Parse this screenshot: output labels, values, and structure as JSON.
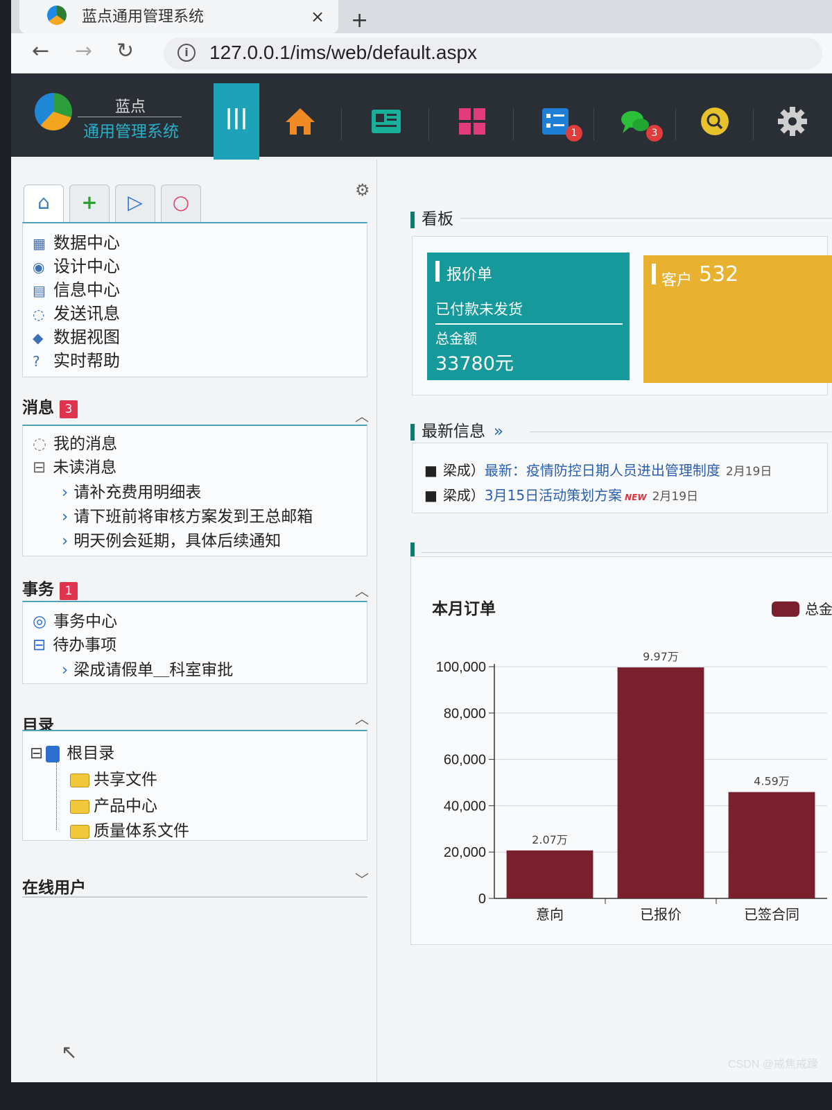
{
  "browser": {
    "tab_title": "蓝点通用管理系统",
    "tab_close": "×",
    "new_tab": "+",
    "back": "←",
    "forward": "→",
    "reload": "↻",
    "info": "i",
    "url": "127.0.0.1/ims/web/default.aspx"
  },
  "header": {
    "logo_top": "蓝点",
    "logo_bottom": "通用管理系统",
    "menu_toggle": "|||",
    "tasks_badge": "1",
    "chat_badge": "3",
    "colors": {
      "header_bg": "#2a2f36",
      "toggle": "#1ea2b8"
    }
  },
  "sidebar": {
    "menu": [
      {
        "icon": "grid-icon",
        "glyph": "▦",
        "label": "数据中心"
      },
      {
        "icon": "palette-icon",
        "glyph": "◉",
        "label": "设计中心"
      },
      {
        "icon": "document-icon",
        "glyph": "▤",
        "label": "信息中心"
      },
      {
        "icon": "chat-icon",
        "glyph": "◌",
        "label": "发送讯息"
      },
      {
        "icon": "layers-icon",
        "glyph": "◆",
        "label": "数据视图"
      },
      {
        "icon": "help-icon",
        "glyph": "?",
        "label": "实时帮助"
      }
    ],
    "messages": {
      "title": "消息",
      "badge": "3",
      "my_messages": "我的消息",
      "unread": "未读消息",
      "items": [
        "请补充费用明细表",
        "请下班前将审核方案发到王总邮箱",
        "明天例会延期，具体后续通知"
      ]
    },
    "affairs": {
      "title": "事务",
      "badge": "1",
      "center": "事务中心",
      "todo": "待办事项",
      "items": [
        "梁成请假单＿科室审批"
      ]
    },
    "catalog": {
      "title": "目录",
      "root": "根目录",
      "folders": [
        "共享文件",
        "产品中心",
        "质量体系文件"
      ]
    },
    "online_users": {
      "title": "在线用户"
    }
  },
  "board": {
    "title": "看板",
    "quote_card": {
      "title": "报价单",
      "status": "已付款未发货",
      "total_label": "总金额",
      "total_value": "33780元"
    },
    "customer_card": {
      "label": "客户",
      "value": "532"
    }
  },
  "news": {
    "title": "最新信息",
    "more": "»",
    "items": [
      {
        "author": "梁成）",
        "link": "最新：疫情防控日期人员进出管理制度",
        "tag": "",
        "date": "2月19日"
      },
      {
        "author": "梁成）",
        "link": "3月15日活动策划方案",
        "tag": "NEW",
        "date": "2月19日"
      }
    ]
  },
  "chart_data": {
    "type": "bar",
    "title": "本月订单",
    "legend": "总金",
    "categories": [
      "意向",
      "已报价",
      "已签合同"
    ],
    "values": [
      20700,
      99700,
      45900
    ],
    "data_labels": [
      "2.07万",
      "9.97万",
      "4.59万"
    ],
    "ylim": [
      0,
      100000
    ],
    "yticks": [
      "0",
      "20,000",
      "40,000",
      "60,000",
      "80,000",
      "100,000"
    ],
    "color": "#7a1f2e"
  },
  "watermark": "CSDN @戒焦戒躁"
}
